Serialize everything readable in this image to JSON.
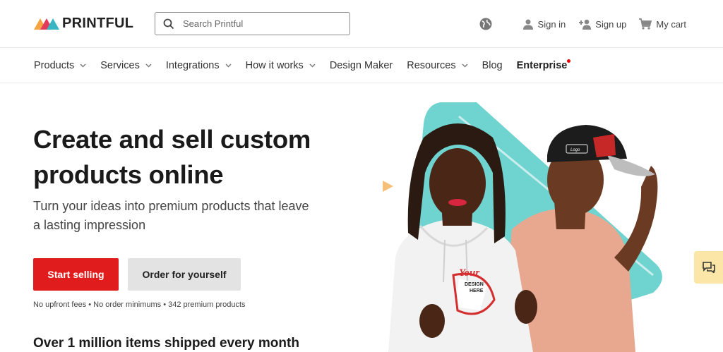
{
  "brand": {
    "name": "PRINTFUL"
  },
  "search": {
    "placeholder": "Search Printful"
  },
  "top_actions": {
    "sign_in": "Sign in",
    "sign_up": "Sign up",
    "cart": "My cart"
  },
  "nav": {
    "items": [
      {
        "label": "Products",
        "dropdown": true
      },
      {
        "label": "Services",
        "dropdown": true
      },
      {
        "label": "Integrations",
        "dropdown": true
      },
      {
        "label": "How it works",
        "dropdown": true
      },
      {
        "label": "Design Maker",
        "dropdown": false
      },
      {
        "label": "Resources",
        "dropdown": true
      },
      {
        "label": "Blog",
        "dropdown": false
      },
      {
        "label": "Enterprise",
        "dropdown": false
      }
    ]
  },
  "hero": {
    "title": "Create and sell custom products online",
    "subtitle": "Turn your ideas into premium products that leave a lasting impression",
    "primary_cta": "Start selling",
    "secondary_cta": "Order for yourself",
    "fine_print": "No upfront fees • No order minimums • 342 premium products",
    "stat_heading": "Over 1 million items shipped every month"
  },
  "hero_image": {
    "hoodie_print": [
      "Your",
      "DESIGN",
      "HERE"
    ],
    "cap_print": "Logo"
  },
  "colors": {
    "accent": "#e11c1c",
    "teal": "#6fd3d0",
    "chat_bg": "#fbe6a8"
  }
}
